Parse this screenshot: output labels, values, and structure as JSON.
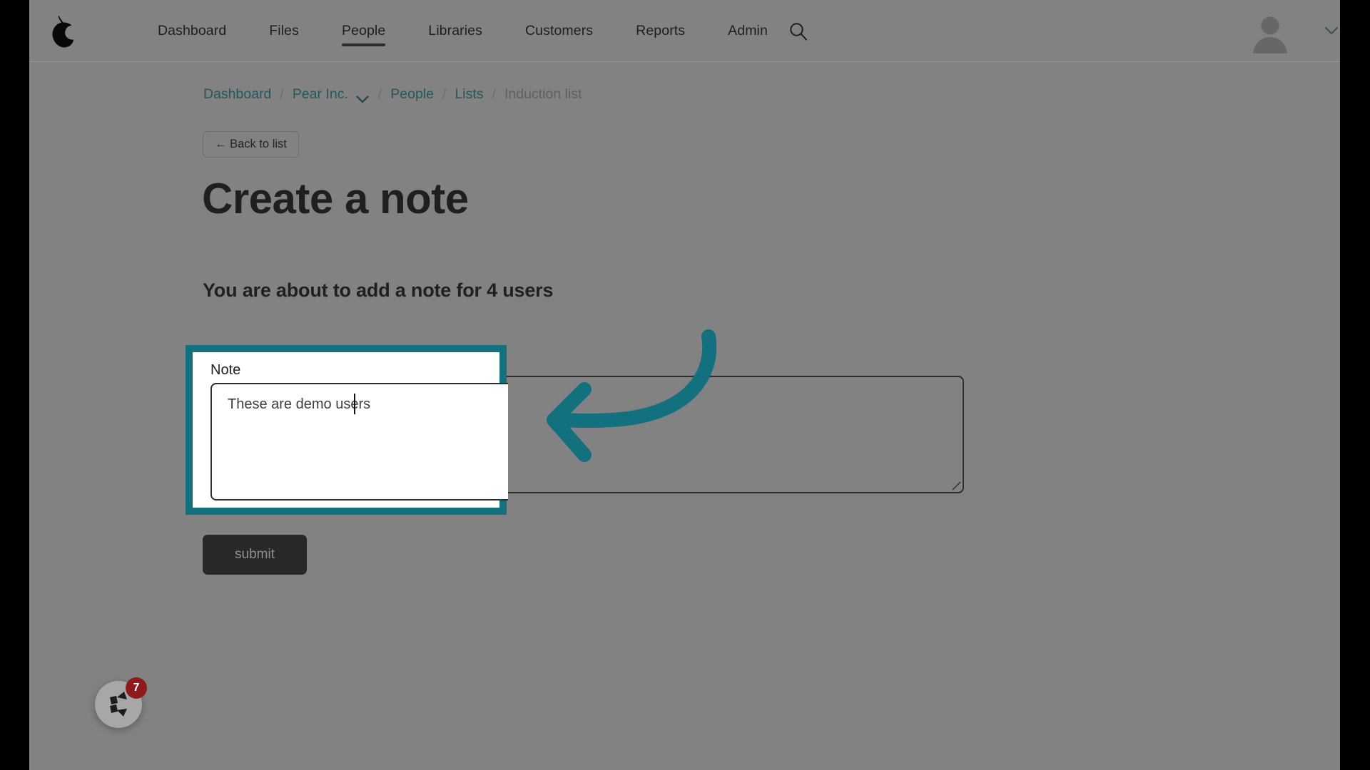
{
  "app": {
    "logo_icon": "pear-logo-icon",
    "accent_teal": "#13707F",
    "page_background": "#828282",
    "letterbox_color": "#000000"
  },
  "navbar": {
    "items": [
      {
        "label": "Dashboard",
        "active": false
      },
      {
        "label": "Files",
        "active": false
      },
      {
        "label": "People",
        "active": true
      },
      {
        "label": "Libraries",
        "active": false
      },
      {
        "label": "Customers",
        "active": false
      },
      {
        "label": "Reports",
        "active": false
      },
      {
        "label": "Admin",
        "active": false
      }
    ],
    "search_icon": "search-icon",
    "avatar_icon": "user-avatar-icon",
    "avatar_chevron_icon": "chevron-down-icon"
  },
  "breadcrumb": {
    "separator": "/",
    "items": [
      {
        "label": "Dashboard",
        "current": false,
        "has_chevron": false
      },
      {
        "label": "Pear Inc.",
        "current": false,
        "has_chevron": true
      },
      {
        "label": "People",
        "current": false,
        "has_chevron": false
      },
      {
        "label": "Lists",
        "current": false,
        "has_chevron": false
      },
      {
        "label": "Induction list",
        "current": true,
        "has_chevron": false
      }
    ],
    "link_color": "#27575C",
    "current_color": "#5F6161"
  },
  "main": {
    "back_button_label": "← Back to list",
    "page_title": "Create a note",
    "sub_title": "You are about to add a note for 4 users",
    "submit_label": "submit"
  },
  "note_field": {
    "label": "Note",
    "value": "These are demo users",
    "placeholder": "",
    "focused": true,
    "highlight_color": "#13707F",
    "resize_handle_icon": "resize-grip-icon"
  },
  "annotation": {
    "arrow_icon": "curved-arrow-left-icon",
    "color": "#13707F"
  },
  "help_widget": {
    "icon": "chameleon-logo-icon",
    "badge_count": "7",
    "badge_color": "#8D1B1B"
  }
}
